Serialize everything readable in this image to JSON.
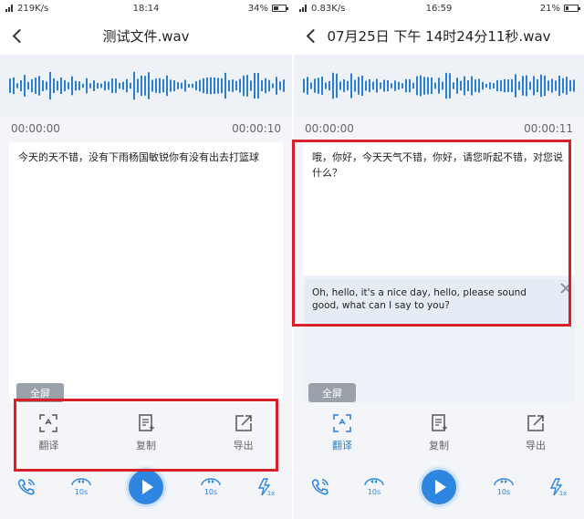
{
  "left": {
    "status": {
      "speed": "219K/s",
      "time": "18:14",
      "battery": "34%"
    },
    "title": "测试文件.wav",
    "time_start": "00:00:00",
    "time_end": "00:00:10",
    "transcript": "今天的天不错，没有下雨杨国敏锐你有没有出去打篮球",
    "fullscreen_label": "全屏",
    "actions": {
      "translate": "翻译",
      "copy": "复制",
      "export": "导出"
    },
    "player": {
      "rewind_label": "10s",
      "forward_label": "10s",
      "speed_label": "1x"
    }
  },
  "right": {
    "status": {
      "speed": "0.83K/s",
      "time": "16:59",
      "battery": "21%"
    },
    "title": "07月25日 下午 14时24分11秒.wav",
    "time_start": "00:00:00",
    "time_end": "00:00:11",
    "transcript": "哦，你好，今天天气不错，你好，请您听起不错，对您说什么？",
    "translation": "Oh, hello, it's a nice day, hello, please sound good, what can I say to you?",
    "fullscreen_label": "全屏",
    "actions": {
      "translate": "翻译",
      "copy": "复制",
      "export": "导出"
    },
    "player": {
      "rewind_label": "10s",
      "forward_label": "10s",
      "speed_label": "1x"
    }
  },
  "colors": {
    "accent": "#2f86e0",
    "highlight_box": "#d8202a",
    "wave": "#2a7fd0"
  },
  "icons": [
    "back-icon",
    "waveform",
    "translate-icon",
    "copy-icon",
    "export-icon",
    "phone-icon",
    "rewind-10s-icon",
    "play-icon",
    "forward-10s-icon",
    "speed-icon"
  ]
}
